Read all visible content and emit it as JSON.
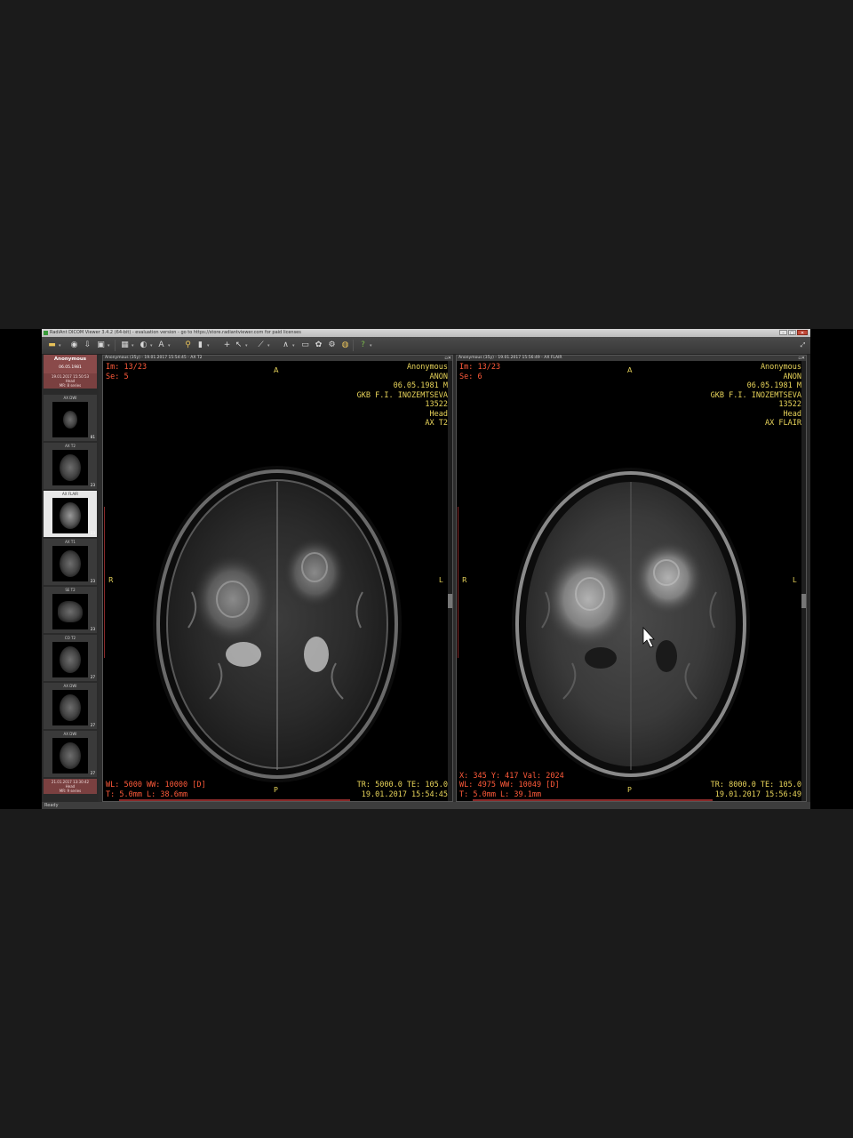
{
  "window": {
    "title": "RadiAnt DICOM Viewer 3.4.2 (64-bit) - evaluation version - go to https://store.radiantviewer.com for paid licenses"
  },
  "toolbar": {
    "icons": [
      "open-folder-icon",
      "cd-icon",
      "download-icon",
      "save-icon",
      "layout-grid-icon",
      "brightness-icon",
      "text-annotation-icon",
      "magnifier-icon",
      "scroll-icon",
      "crosshair-icon",
      "pointer-icon",
      "ruler-icon",
      "angle-icon",
      "ellipse-icon",
      "pan-icon",
      "camera-icon",
      "3d-volume-icon",
      "globe-icon",
      "settings-icon",
      "help-icon"
    ]
  },
  "sidebar": {
    "patient_name": "Anonymous",
    "patient_dob": "06.05.1981",
    "study1": {
      "line1": "19.01.2017 15:50:53",
      "line2": "Head",
      "line3": "MR: 8 series"
    },
    "series": [
      {
        "label": "AX DWI",
        "count": "81"
      },
      {
        "label": "AX T2",
        "count": "23"
      },
      {
        "label": "AX FLAIR",
        "count": "23"
      },
      {
        "label": "AX T1",
        "count": "23"
      },
      {
        "label": "SE T2",
        "count": "23"
      },
      {
        "label": "CO T2",
        "count": "27"
      },
      {
        "label": "AX DWI",
        "count": "27"
      },
      {
        "label": "AX DWI",
        "count": "27"
      }
    ],
    "study2": {
      "line1": "21.01.2017 13:30:42",
      "line2": "Head",
      "line3": "MR: 9 series"
    }
  },
  "viewer_left": {
    "header": "Anonymous (35y) - 19.01.2017 15:54:45 - AX T2",
    "im": "Im: 13/23",
    "se": "Se: 5",
    "patient": [
      "Anonymous",
      "ANON",
      "06.05.1981 M",
      "GKB F.I. INOZEMTSEVA",
      "13522",
      "Head",
      "AX T2"
    ],
    "orient": {
      "top": "A",
      "bottom": "P",
      "left": "R",
      "right": "L"
    },
    "bottom_left": [
      "WL: 5000 WW: 10000 [D]",
      "T: 5.0mm L: 38.6mm"
    ],
    "bottom_right": [
      "TR: 5000.0 TE: 105.0",
      "19.01.2017 15:54:45"
    ]
  },
  "viewer_right": {
    "header": "Anonymous (35y) - 19.01.2017 15:56:49 - AX FLAIR",
    "im": "Im: 13/23",
    "se": "Se: 6",
    "patient": [
      "Anonymous",
      "ANON",
      "06.05.1981 M",
      "GKB F.I. INOZEMTSEVA",
      "13522",
      "Head",
      "AX FLAIR"
    ],
    "orient": {
      "top": "A",
      "bottom": "P",
      "left": "R",
      "right": "L"
    },
    "cursor_readout": "X: 345 Y: 417 Val: 2024",
    "bottom_left": [
      "WL: 4975 WW: 10049 [D]",
      "T: 5.0mm L: 39.1mm"
    ],
    "bottom_right": [
      "TR: 8000.0 TE: 105.0",
      "19.01.2017 15:56:49"
    ]
  },
  "status": {
    "text": "Ready"
  },
  "colors": {
    "overlay_red": "#ff5a3a",
    "overlay_yellow": "#e8d45a",
    "patient_header": "#8a4a4a"
  }
}
